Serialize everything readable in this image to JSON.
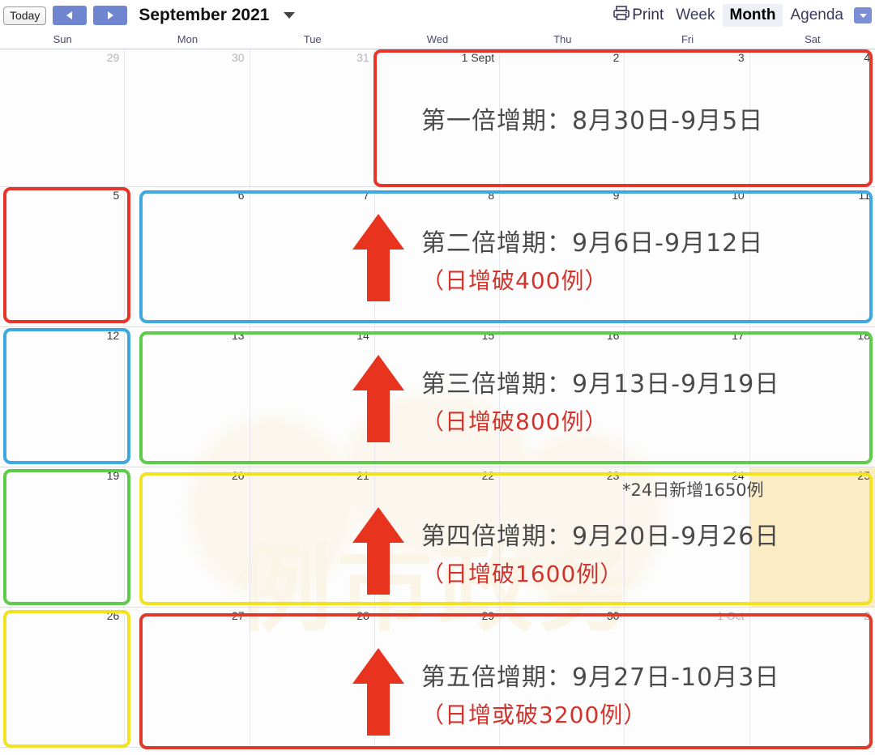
{
  "toolbar": {
    "today_label": "Today",
    "prev_label": "prev-month",
    "next_label": "next-month",
    "month_title": "September 2021",
    "print_label": "Print",
    "views": [
      {
        "label": "Week",
        "active": false
      },
      {
        "label": "Month",
        "active": true
      },
      {
        "label": "Agenda",
        "active": false
      }
    ]
  },
  "weekdays": [
    "Sun",
    "Mon",
    "Tue",
    "Wed",
    "Thu",
    "Fri",
    "Sat"
  ],
  "weeks": [
    {
      "days": [
        {
          "num": "29",
          "muted": true,
          "highlight": false
        },
        {
          "num": "30",
          "muted": true,
          "highlight": false
        },
        {
          "num": "31",
          "muted": true,
          "highlight": false
        },
        {
          "num": "1 Sept",
          "muted": false,
          "highlight": false
        },
        {
          "num": "2",
          "muted": false,
          "highlight": false
        },
        {
          "num": "3",
          "muted": false,
          "highlight": false
        },
        {
          "num": "4",
          "muted": false,
          "highlight": false
        }
      ]
    },
    {
      "days": [
        {
          "num": "5",
          "muted": false,
          "highlight": false
        },
        {
          "num": "6",
          "muted": false,
          "highlight": false
        },
        {
          "num": "7",
          "muted": false,
          "highlight": false
        },
        {
          "num": "8",
          "muted": false,
          "highlight": false
        },
        {
          "num": "9",
          "muted": false,
          "highlight": false
        },
        {
          "num": "10",
          "muted": false,
          "highlight": false
        },
        {
          "num": "11",
          "muted": false,
          "highlight": false
        }
      ]
    },
    {
      "days": [
        {
          "num": "12",
          "muted": false,
          "highlight": false
        },
        {
          "num": "13",
          "muted": false,
          "highlight": false
        },
        {
          "num": "14",
          "muted": false,
          "highlight": false
        },
        {
          "num": "15",
          "muted": false,
          "highlight": false
        },
        {
          "num": "16",
          "muted": false,
          "highlight": false
        },
        {
          "num": "17",
          "muted": false,
          "highlight": false
        },
        {
          "num": "18",
          "muted": false,
          "highlight": false
        }
      ]
    },
    {
      "days": [
        {
          "num": "19",
          "muted": false,
          "highlight": false
        },
        {
          "num": "20",
          "muted": false,
          "highlight": false
        },
        {
          "num": "21",
          "muted": false,
          "highlight": false
        },
        {
          "num": "22",
          "muted": false,
          "highlight": false
        },
        {
          "num": "23",
          "muted": false,
          "highlight": false
        },
        {
          "num": "24",
          "muted": false,
          "highlight": false
        },
        {
          "num": "25",
          "muted": false,
          "highlight": true
        }
      ]
    },
    {
      "days": [
        {
          "num": "26",
          "muted": false,
          "highlight": false
        },
        {
          "num": "27",
          "muted": false,
          "highlight": false
        },
        {
          "num": "28",
          "muted": false,
          "highlight": false
        },
        {
          "num": "29",
          "muted": false,
          "highlight": false
        },
        {
          "num": "30",
          "muted": false,
          "highlight": false
        },
        {
          "num": "1 Oct",
          "muted": true,
          "highlight": false
        },
        {
          "num": "2",
          "muted": true,
          "highlight": false
        }
      ]
    }
  ],
  "annotations": [
    {
      "id": "doubling-period-1",
      "main": "第一倍增期：8月30日-9月5日",
      "sub": "",
      "arrow": false,
      "color": "#e8352a"
    },
    {
      "id": "doubling-period-2",
      "main": "第二倍增期：9月6日-9月12日",
      "sub": "（日增破400例）",
      "arrow": true,
      "color": "#3fa8e0"
    },
    {
      "id": "doubling-period-3",
      "main": "第三倍增期：9月13日-9月19日",
      "sub": "（日增破800例）",
      "arrow": true,
      "color": "#5ecb4b"
    },
    {
      "id": "doubling-period-4",
      "main": "第四倍增期：9月20日-9月26日",
      "sub": "（日增破1600例）",
      "arrow": true,
      "color": "#f2e320"
    },
    {
      "id": "doubling-period-5",
      "main": "第五倍增期：9月27日-10月3日",
      "sub": "（日增或破3200例）",
      "arrow": true,
      "color": "#e03a2c"
    }
  ],
  "note": "*24日新增1650例",
  "sunday_boxes": [
    {
      "id": "sunday-box-5",
      "color": "#e8352a"
    },
    {
      "id": "sunday-box-12",
      "color": "#3fa8e0"
    },
    {
      "id": "sunday-box-19",
      "color": "#5ecb4b"
    },
    {
      "id": "sunday-box-26",
      "color": "#f2e320"
    }
  ],
  "watermark_text": "例市政务"
}
